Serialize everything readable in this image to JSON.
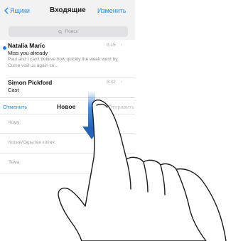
{
  "inbox": {
    "back_label": "Ящики",
    "title": "Входящие",
    "edit_label": "Изменить",
    "search_placeholder": "Поиск",
    "messages": [
      {
        "sender": "Natalia Maric",
        "time": "8:15",
        "subject": "Miss you already",
        "preview": "Paul and I can't believe how quickly the week went by. Come visit us again so...",
        "unread": true
      },
      {
        "sender": "Simon Pickford",
        "time": "8:32",
        "subject": "Cast",
        "unread": false
      }
    ]
  },
  "compose": {
    "cancel_label": "Отменить",
    "title": "Новое",
    "send_label": "Отправить",
    "fields": {
      "to": "Кому:",
      "cc_bcc": "Копия/Скрытая копия:",
      "subject": "Тема:"
    }
  },
  "colors": {
    "accent": "#2a8cf0",
    "unread_dot": "#1e80f0",
    "gesture_arrow": "#2f7bd6"
  },
  "icons": [
    "chevron-left-icon",
    "search-icon",
    "swipe-down-arrow-icon",
    "pointing-hand-icon"
  ]
}
